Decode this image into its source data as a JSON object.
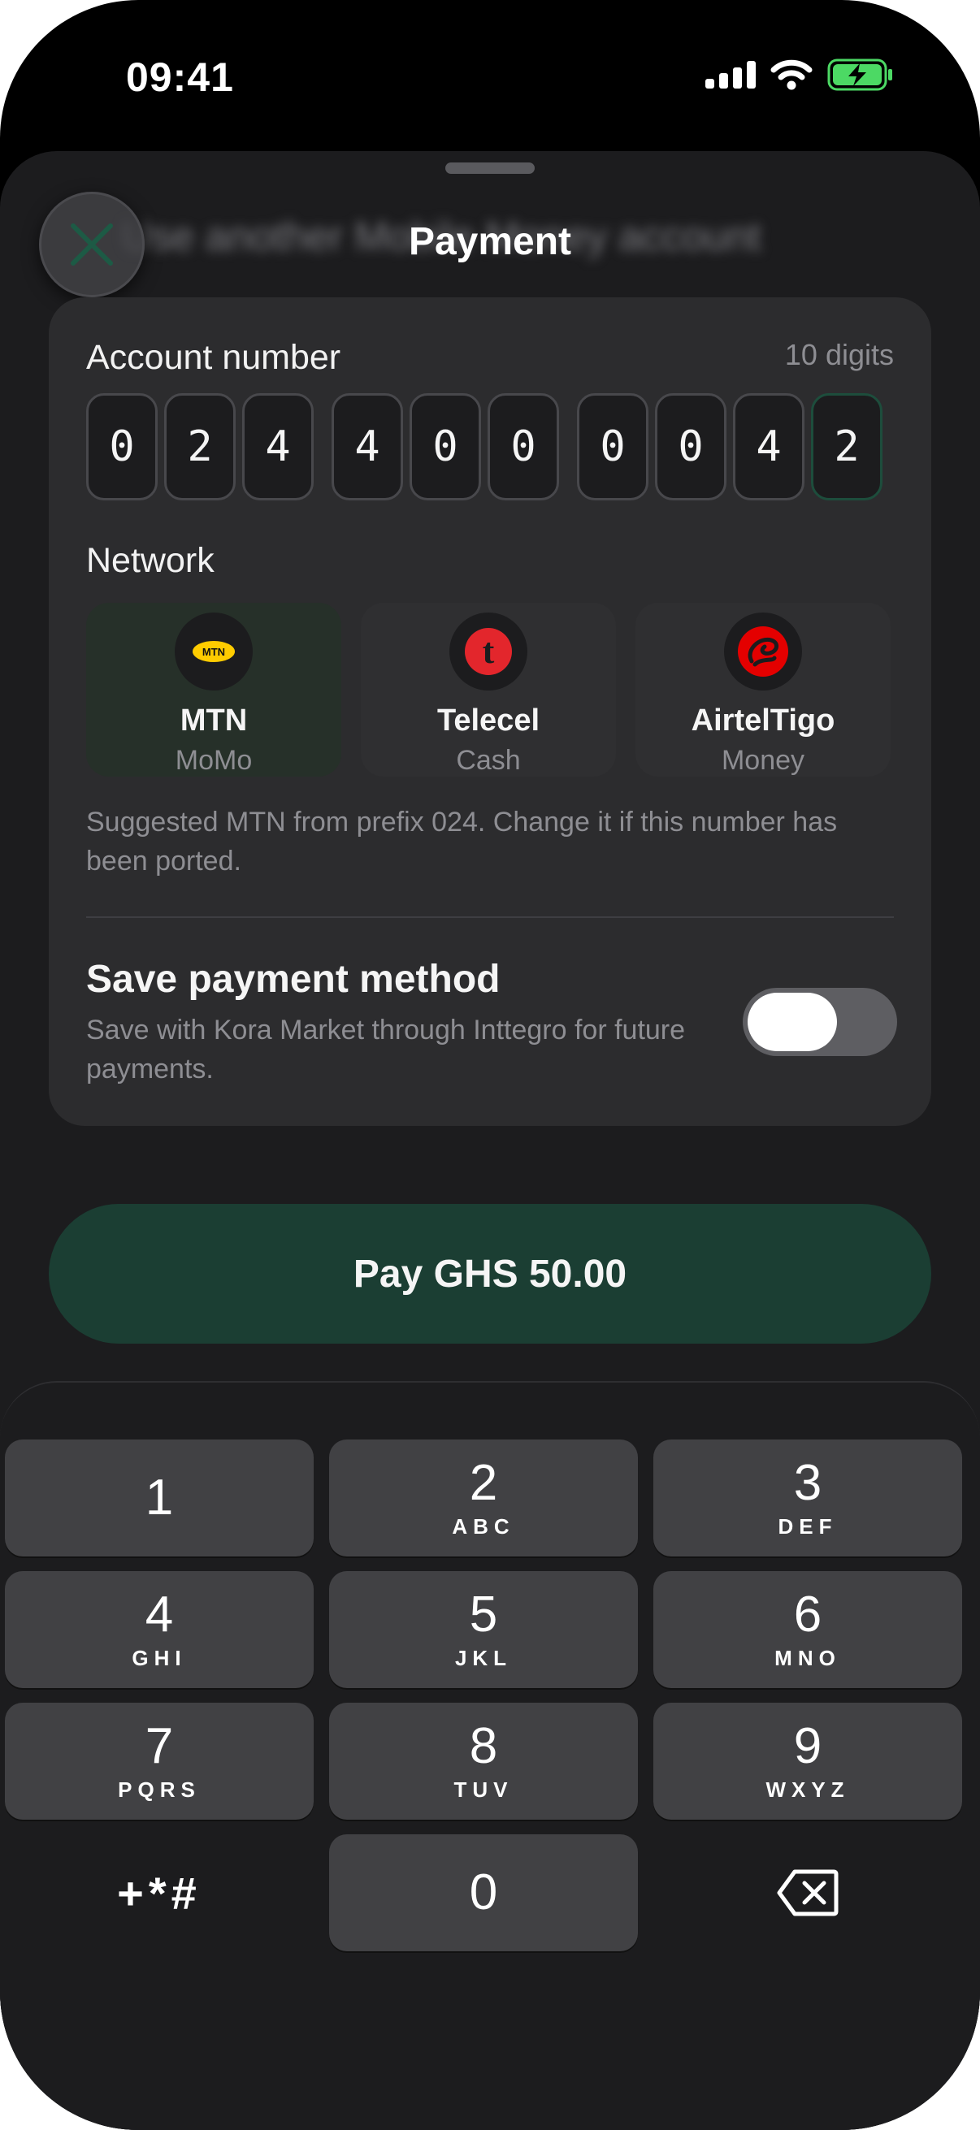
{
  "status": {
    "time": "09:41"
  },
  "background": {
    "blurred_title": "Use another Mobile Money account"
  },
  "sheet": {
    "title": "Payment"
  },
  "account": {
    "label": "Account number",
    "hint": "10 digits",
    "digits": [
      "0",
      "2",
      "4",
      "4",
      "0",
      "0",
      "0",
      "0",
      "4",
      "2"
    ]
  },
  "network": {
    "label": "Network",
    "options": [
      {
        "name": "MTN",
        "sub": "MoMo",
        "logo_text": "MTN"
      },
      {
        "name": "Telecel",
        "sub": "Cash",
        "logo_text": "t"
      },
      {
        "name": "AirtelTigo",
        "sub": "Money"
      }
    ],
    "selected": "MTN",
    "suggestion": "Suggested MTN from prefix 024. Change it if this number has been ported."
  },
  "save": {
    "title": "Save payment method",
    "description": "Save with Kora Market through Inttegro for future payments.",
    "enabled": false
  },
  "pay_button": "Pay GHS 50.00",
  "keypad": {
    "keys": [
      {
        "num": "1",
        "letters": ""
      },
      {
        "num": "2",
        "letters": "ABC"
      },
      {
        "num": "3",
        "letters": "DEF"
      },
      {
        "num": "4",
        "letters": "GHI"
      },
      {
        "num": "5",
        "letters": "JKL"
      },
      {
        "num": "6",
        "letters": "MNO"
      },
      {
        "num": "7",
        "letters": "PQRS"
      },
      {
        "num": "8",
        "letters": "TUV"
      },
      {
        "num": "9",
        "letters": "WXYZ"
      },
      {
        "num": "0",
        "letters": ""
      }
    ],
    "symbols": "+*#"
  },
  "colors": {
    "accent": "#1b3e33",
    "mtn_yellow": "#ffcc00",
    "telecel_red": "#e3262c",
    "airtel_red": "#e40000"
  },
  "icons": {
    "close": "close-x-icon",
    "backspace": "backspace-icon"
  }
}
